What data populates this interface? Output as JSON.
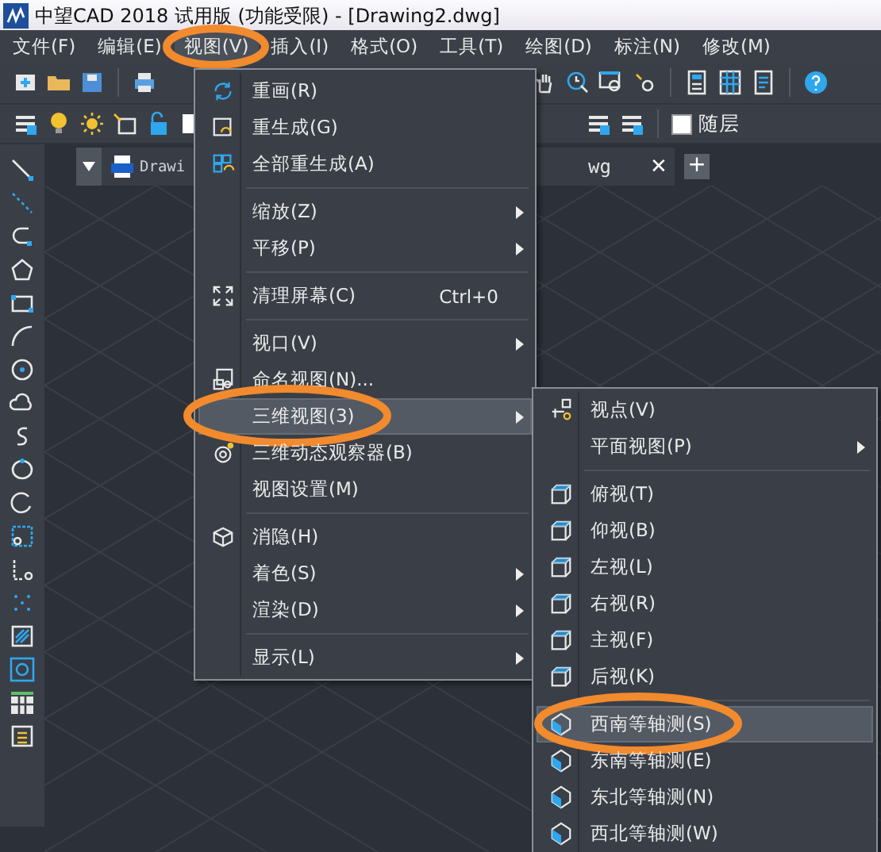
{
  "window": {
    "title": "中望CAD 2018 试用版 (功能受限) - [Drawing2.dwg]"
  },
  "menubar": [
    {
      "label": "文件(F)",
      "selected": false,
      "circled": false
    },
    {
      "label": "编辑(E)",
      "selected": false,
      "circled": false
    },
    {
      "label": "视图(V)",
      "selected": true,
      "circled": true
    },
    {
      "label": "插入(I)",
      "selected": false,
      "circled": false
    },
    {
      "label": "格式(O)",
      "selected": false,
      "circled": false
    },
    {
      "label": "工具(T)",
      "selected": false,
      "circled": false
    },
    {
      "label": "绘图(D)",
      "selected": false,
      "circled": false
    },
    {
      "label": "标注(N)",
      "selected": false,
      "circled": false
    },
    {
      "label": "修改(M)",
      "selected": false,
      "circled": false
    }
  ],
  "layer_toolbar": {
    "label": "随层",
    "checked": false
  },
  "tab": {
    "label_start": "Drawi",
    "label_end": "wg",
    "close": "✕",
    "add": "+"
  },
  "view_menu": [
    {
      "kind": "item",
      "label": "重画(R)",
      "submenu": false,
      "selected": false,
      "circled": false
    },
    {
      "kind": "item",
      "label": "重生成(G)",
      "submenu": false,
      "selected": false,
      "circled": false
    },
    {
      "kind": "item",
      "label": "全部重生成(A)",
      "submenu": false,
      "selected": false,
      "circled": false
    },
    {
      "kind": "separator"
    },
    {
      "kind": "item",
      "label": "缩放(Z)",
      "submenu": true,
      "selected": false,
      "circled": false
    },
    {
      "kind": "item",
      "label": "平移(P)",
      "submenu": true,
      "selected": false,
      "circled": false
    },
    {
      "kind": "separator"
    },
    {
      "kind": "item",
      "label": "清理屏幕(C)",
      "shortcut": "Ctrl+0",
      "submenu": false,
      "selected": false,
      "circled": false
    },
    {
      "kind": "separator"
    },
    {
      "kind": "item",
      "label": "视口(V)",
      "submenu": true,
      "selected": false,
      "circled": false
    },
    {
      "kind": "item",
      "label": "命名视图(N)...",
      "submenu": false,
      "selected": false,
      "circled": false
    },
    {
      "kind": "item",
      "label": "三维视图(3)",
      "submenu": true,
      "selected": true,
      "circled": true
    },
    {
      "kind": "item",
      "label": "三维动态观察器(B)",
      "submenu": false,
      "selected": false,
      "circled": false
    },
    {
      "kind": "item",
      "label": "视图设置(M)",
      "submenu": false,
      "selected": false,
      "circled": false
    },
    {
      "kind": "separator"
    },
    {
      "kind": "item",
      "label": "消隐(H)",
      "submenu": false,
      "selected": false,
      "circled": false
    },
    {
      "kind": "item",
      "label": "着色(S)",
      "submenu": true,
      "selected": false,
      "circled": false
    },
    {
      "kind": "item",
      "label": "渲染(D)",
      "submenu": true,
      "selected": false,
      "circled": false
    },
    {
      "kind": "separator"
    },
    {
      "kind": "item",
      "label": "显示(L)",
      "submenu": true,
      "selected": false,
      "circled": false
    }
  ],
  "view3d_menu": [
    {
      "kind": "item",
      "label": "视点(V)",
      "submenu": false,
      "selected": false,
      "circled": false
    },
    {
      "kind": "item",
      "label": "平面视图(P)",
      "submenu": true,
      "selected": false,
      "circled": false
    },
    {
      "kind": "separator"
    },
    {
      "kind": "item",
      "label": "俯视(T)",
      "submenu": false,
      "selected": false,
      "circled": false
    },
    {
      "kind": "item",
      "label": "仰视(B)",
      "submenu": false,
      "selected": false,
      "circled": false
    },
    {
      "kind": "item",
      "label": "左视(L)",
      "submenu": false,
      "selected": false,
      "circled": false
    },
    {
      "kind": "item",
      "label": "右视(R)",
      "submenu": false,
      "selected": false,
      "circled": false
    },
    {
      "kind": "item",
      "label": "主视(F)",
      "submenu": false,
      "selected": false,
      "circled": false
    },
    {
      "kind": "item",
      "label": "后视(K)",
      "submenu": false,
      "selected": false,
      "circled": false
    },
    {
      "kind": "separator"
    },
    {
      "kind": "item",
      "label": "西南等轴测(S)",
      "submenu": false,
      "selected": true,
      "circled": true
    },
    {
      "kind": "item",
      "label": "东南等轴测(E)",
      "submenu": false,
      "selected": false,
      "circled": false
    },
    {
      "kind": "item",
      "label": "东北等轴测(N)",
      "submenu": false,
      "selected": false,
      "circled": false
    },
    {
      "kind": "item",
      "label": "西北等轴测(W)",
      "submenu": false,
      "selected": false,
      "circled": false
    }
  ]
}
